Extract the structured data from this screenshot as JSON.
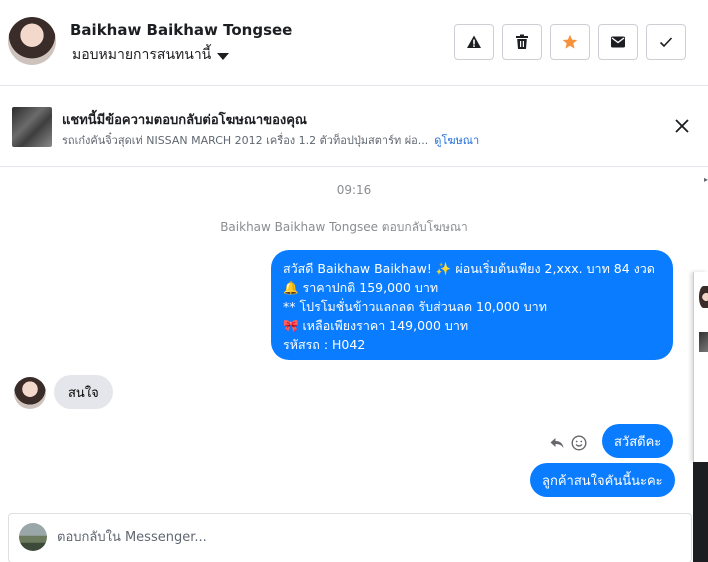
{
  "header": {
    "user_name": "Baikhaw Baikhaw Tongsee",
    "assign_label": "มอบหมายการสนทนานี้",
    "actions": [
      "warning-icon",
      "trash-icon",
      "star-icon",
      "mail-icon",
      "check-icon"
    ],
    "star_color": "#f7923b"
  },
  "ad_banner": {
    "title": "แชทนี้มีข้อความตอบกลับต่อโฆษณาของคุณ",
    "subtitle": "รถเก๋งคันจิ๋วสุดเท่ NISSAN MARCH 2012 เครื่อง 1.2 ตัวท็อปปุ่มสตาร์ท ผ่อ...",
    "link": "ดูโฆษณา"
  },
  "conversation": {
    "timestamp": "09:16",
    "reply_note": "Baikhaw Baikhaw Tongsee ตอบกลับโฆษณา",
    "outgoing_ad_message": {
      "line1": "สวัสดี Baikhaw Baikhaw! ✨  ผ่อนเริ่มต้นเพียง 2,xxx. บาท 84 งวด",
      "line2": "🔔 ราคาปกติ  159,000 บาท",
      "line3": "** โปรโมชั่นข้าวแลกลด รับส่วนลด 10,000 บาท",
      "line4": "🎀  เหลือเพียงราคา 149,000 บาท",
      "line5": " รหัสรถ : H042"
    },
    "incoming_message": "สนใจ",
    "outgoing_1": "สวัสดีคะ",
    "outgoing_2": "ลูกค้าสนใจคันนี้นะคะ",
    "bubble_color": "#0a7cff"
  },
  "composer": {
    "placeholder": "ตอบกลับใน Messenger..."
  }
}
